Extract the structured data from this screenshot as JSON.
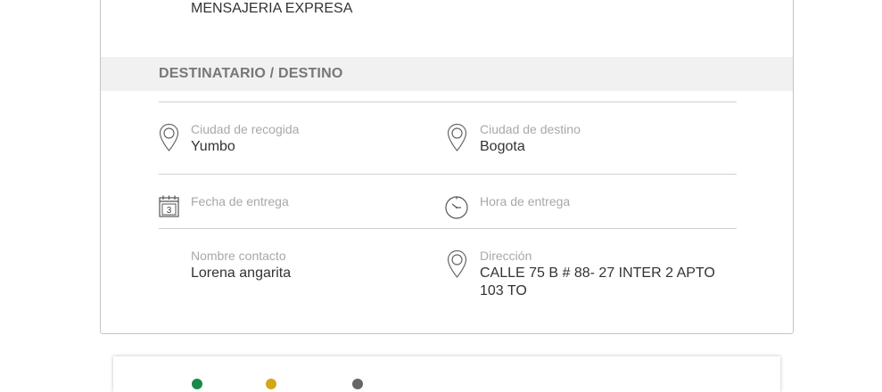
{
  "service": {
    "type_text": "MENSAJERIA EXPRESA"
  },
  "section": {
    "title": "DESTINATARIO / DESTINO"
  },
  "pickup_city": {
    "label": "Ciudad de recogida",
    "value": "Yumbo",
    "icon": "map-pin-icon"
  },
  "destination_city": {
    "label": "Ciudad de destino",
    "value": "Bogota",
    "icon": "map-pin-icon"
  },
  "delivery_date": {
    "label": "Fecha de entrega",
    "value": "",
    "icon": "calendar-icon",
    "icon_text": "3"
  },
  "delivery_time": {
    "label": "Hora de entrega",
    "value": "",
    "icon": "clock-icon"
  },
  "contact_name": {
    "label": "Nombre contacto",
    "value": "Lorena angarita"
  },
  "address": {
    "label": "Dirección",
    "value": "CALLE 75 B # 88- 27 INTER 2 APTO 103 TO",
    "icon": "map-pin-icon"
  },
  "status_dots": [
    {
      "name": "green",
      "color": "#1a8a4a"
    },
    {
      "name": "yellow",
      "color": "#d4a617"
    },
    {
      "name": "gray",
      "color": "#666666"
    }
  ]
}
